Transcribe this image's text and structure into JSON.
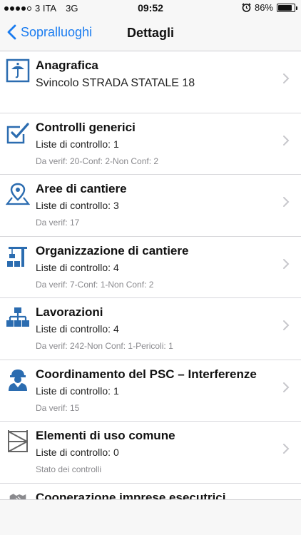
{
  "status": {
    "carrier": "3 ITA",
    "network": "3G",
    "time": "09:52",
    "battery": "86%",
    "battery_level": 0.86
  },
  "nav": {
    "back_label": "Sopralluoghi",
    "title": "Dettagli"
  },
  "colors": {
    "accent": "#1a7cf0",
    "icon": "#2b6cb0"
  },
  "rows": [
    {
      "icon": "umbrella-document-icon",
      "title": "Anagrafica",
      "sub": "Svincolo STRADA STATALE 18"
    },
    {
      "icon": "checkbox-icon",
      "title": "Controlli generici",
      "sub": "Liste di controllo: 1",
      "detail": "Da verif: 20-Conf: 2-Non Conf: 2"
    },
    {
      "icon": "map-pin-icon",
      "title": "Aree di cantiere",
      "sub": "Liste di controllo: 3",
      "detail": "Da verif: 17"
    },
    {
      "icon": "crane-icon",
      "title": "Organizzazione di cantiere",
      "sub": "Liste di controllo: 4",
      "detail": "Da verif: 7-Conf: 1-Non Conf: 2"
    },
    {
      "icon": "hierarchy-icon",
      "title": "Lavorazioni",
      "sub": "Liste di controllo: 4",
      "detail": "Da verif: 242-Non Conf: 1-Pericoli: 1"
    },
    {
      "icon": "worker-icon",
      "title": "Coordinamento del PSC – Interferenze",
      "sub": "Liste di controllo: 1",
      "detail": "Da verif: 15"
    },
    {
      "icon": "scaffold-icon",
      "title": "Elementi di uso comune",
      "sub": "Liste di controllo: 0",
      "detail": "Stato dei controlli"
    },
    {
      "icon": "handshake-icon",
      "title": "Cooperazione imprese esecutrici"
    }
  ]
}
